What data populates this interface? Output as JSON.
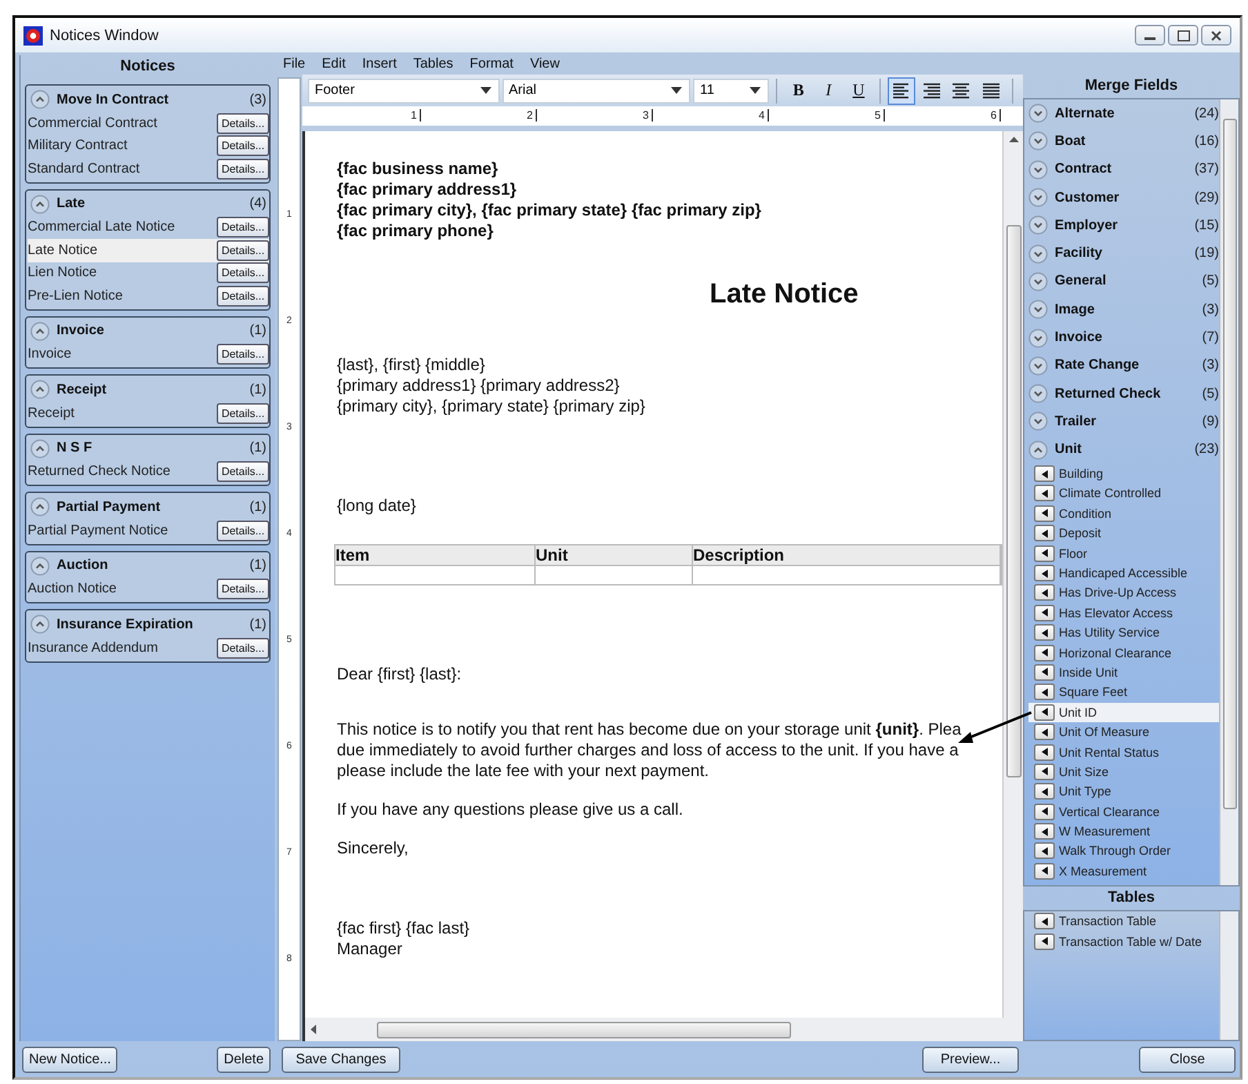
{
  "window": {
    "title": "Notices Window"
  },
  "notices": {
    "title": "Notices",
    "groups": [
      {
        "name": "Move In Contract",
        "count": "(3)",
        "expanded": true,
        "items": [
          {
            "label": "Commercial Contract",
            "button": "Details...",
            "selected": false
          },
          {
            "label": "Military Contract",
            "button": "Details...",
            "selected": false
          },
          {
            "label": "Standard Contract",
            "button": "Details...",
            "selected": false
          }
        ]
      },
      {
        "name": "Late",
        "count": "(4)",
        "expanded": true,
        "items": [
          {
            "label": "Commercial Late Notice",
            "button": "Details...",
            "selected": false
          },
          {
            "label": "Late Notice",
            "button": "Details...",
            "selected": true
          },
          {
            "label": "Lien Notice",
            "button": "Details...",
            "selected": false
          },
          {
            "label": "Pre-Lien Notice",
            "button": "Details...",
            "selected": false
          }
        ]
      },
      {
        "name": "Invoice",
        "count": "(1)",
        "expanded": true,
        "items": [
          {
            "label": "Invoice",
            "button": "Details...",
            "selected": false
          }
        ]
      },
      {
        "name": "Receipt",
        "count": "(1)",
        "expanded": true,
        "items": [
          {
            "label": "Receipt",
            "button": "Details...",
            "selected": false
          }
        ]
      },
      {
        "name": "N S F",
        "count": "(1)",
        "expanded": true,
        "items": [
          {
            "label": "Returned Check Notice",
            "button": "Details...",
            "selected": false
          }
        ]
      },
      {
        "name": "Partial Payment",
        "count": "(1)",
        "expanded": true,
        "items": [
          {
            "label": "Partial Payment Notice",
            "button": "Details...",
            "selected": false
          }
        ]
      },
      {
        "name": "Auction",
        "count": "(1)",
        "expanded": true,
        "items": [
          {
            "label": "Auction Notice",
            "button": "Details...",
            "selected": false
          }
        ]
      },
      {
        "name": "Insurance Expiration",
        "count": "(1)",
        "expanded": true,
        "items": [
          {
            "label": "Insurance Addendum",
            "button": "Details...",
            "selected": false
          }
        ]
      }
    ],
    "buttons": [
      "New Notice...",
      "Delete"
    ]
  },
  "menu": [
    "File",
    "Edit",
    "Insert",
    "Tables",
    "Format",
    "View"
  ],
  "toolbar": {
    "style": "Footer",
    "font": "Arial",
    "size": "11",
    "format_buttons": [
      {
        "kind": "bold",
        "label": "B"
      },
      {
        "kind": "italic",
        "label": "I"
      },
      {
        "kind": "underline",
        "label": "U"
      }
    ],
    "align_buttons": [
      {
        "kind": "left",
        "selected": true
      },
      {
        "kind": "right",
        "selected": false
      },
      {
        "kind": "center",
        "selected": false
      },
      {
        "kind": "justify",
        "selected": false
      }
    ]
  },
  "ruler": {
    "horizontal": [
      "1",
      "2",
      "3",
      "4",
      "5",
      "6"
    ],
    "vertical": [
      "1",
      "2",
      "3",
      "4",
      "5",
      "6",
      "7",
      "8"
    ]
  },
  "document": {
    "header_lines": [
      "{fac business name}",
      "{fac primary address1}",
      "{fac primary city}, {fac primary state}  {fac primary zip}",
      "{fac primary phone}"
    ],
    "title": "Late Notice",
    "address_lines": [
      "{last}, {first} {middle}",
      "{primary address1} {primary address2}",
      "{primary city}, {primary state} {primary zip}"
    ],
    "date": "{long date}",
    "table": {
      "columns": [
        "Item",
        "Unit",
        "Description"
      ]
    },
    "salutation": "Dear {first} {last}:",
    "paragraph_lines": [
      "This notice is to notify you that rent has become due on your storage unit **{unit}**. Plea",
      "due immediately to avoid further charges and loss of access to the unit. If you have a",
      "please include the late fee with your next payment."
    ],
    "questions": "If you have any questions please give us a call.",
    "closing": "Sincerely,",
    "signature_lines": [
      "{fac first} {fac last}",
      "Manager"
    ]
  },
  "editor_buttons": [
    "Save Changes",
    "Preview..."
  ],
  "merge_fields": {
    "title": "Merge Fields",
    "groups": [
      {
        "name": "Alternate",
        "count": "(24)",
        "expanded": false
      },
      {
        "name": "Boat",
        "count": "(16)",
        "expanded": false
      },
      {
        "name": "Contract",
        "count": "(37)",
        "expanded": false
      },
      {
        "name": "Customer",
        "count": "(29)",
        "expanded": false
      },
      {
        "name": "Employer",
        "count": "(15)",
        "expanded": false
      },
      {
        "name": "Facility",
        "count": "(19)",
        "expanded": false
      },
      {
        "name": "General",
        "count": "(5)",
        "expanded": false
      },
      {
        "name": "Image",
        "count": "(3)",
        "expanded": false
      },
      {
        "name": "Invoice",
        "count": "(7)",
        "expanded": false
      },
      {
        "name": "Rate Change",
        "count": "(3)",
        "expanded": false
      },
      {
        "name": "Returned Check",
        "count": "(5)",
        "expanded": false
      },
      {
        "name": "Trailer",
        "count": "(9)",
        "expanded": false
      },
      {
        "name": "Unit",
        "count": "(23)",
        "expanded": true,
        "items": [
          {
            "label": "Building",
            "selected": false
          },
          {
            "label": "Climate Controlled",
            "selected": false
          },
          {
            "label": "Condition",
            "selected": false
          },
          {
            "label": "Deposit",
            "selected": false
          },
          {
            "label": "Floor",
            "selected": false
          },
          {
            "label": "Handicaped Accessible",
            "selected": false
          },
          {
            "label": "Has Drive-Up Access",
            "selected": false
          },
          {
            "label": "Has Elevator Access",
            "selected": false
          },
          {
            "label": "Has Utility Service",
            "selected": false
          },
          {
            "label": "Horizonal Clearance",
            "selected": false
          },
          {
            "label": "Inside Unit",
            "selected": false
          },
          {
            "label": "Square Feet",
            "selected": false
          },
          {
            "label": "Unit ID",
            "selected": true
          },
          {
            "label": "Unit Of Measure",
            "selected": false
          },
          {
            "label": "Unit Rental Status",
            "selected": false
          },
          {
            "label": "Unit Size",
            "selected": false
          },
          {
            "label": "Unit Type",
            "selected": false
          },
          {
            "label": "Vertical Clearance",
            "selected": false
          },
          {
            "label": "W Measurement",
            "selected": false
          },
          {
            "label": "Walk Through Order",
            "selected": false
          },
          {
            "label": "X Measurement",
            "selected": false
          }
        ]
      }
    ]
  },
  "tables": {
    "title": "Tables",
    "items": [
      "Transaction Table",
      "Transaction Table w/ Date"
    ]
  },
  "close_button": "Close"
}
